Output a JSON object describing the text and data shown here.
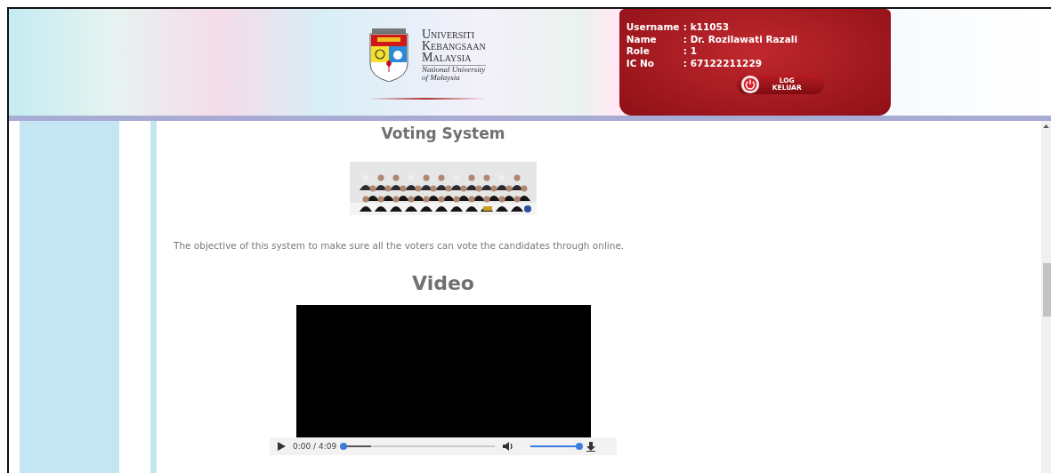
{
  "header": {
    "logo": {
      "lines": [
        "Universiti",
        "Kebangsaan",
        "Malaysia"
      ],
      "subtitle_lines": [
        "National University",
        "of Malaysia"
      ]
    },
    "user_info": [
      {
        "label": "Username",
        "value": ": k11053"
      },
      {
        "label": "Name",
        "value": ": Dr. Rozilawati Razali"
      },
      {
        "label": "Role",
        "value": ": 1"
      },
      {
        "label": "IC No",
        "value": ": 67122211229"
      }
    ],
    "logout_button": {
      "lines": [
        "LOG",
        "KELUAR"
      ]
    }
  },
  "content": {
    "title": "Voting System",
    "description": "The objective of this system to make sure all the voters can vote the candidates through online.",
    "video_heading": "Video",
    "player": {
      "time": "0:00 / 4:09",
      "progress": {
        "level": 0.0
      },
      "volume": {
        "level": 1.0
      }
    }
  }
}
